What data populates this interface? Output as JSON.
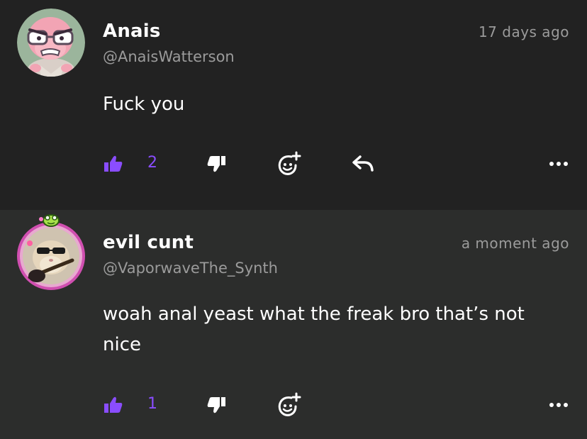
{
  "comments": [
    {
      "username": "Anais",
      "handle": "@AnaisWatterson",
      "timestamp": "17 days ago",
      "text": "Fuck you",
      "likes": "2",
      "has_reply": true
    },
    {
      "username": "evil cunt",
      "handle": "@VaporwaveThe_Synth",
      "timestamp": "a moment ago",
      "text": "woah anal yeast what the freak bro that’s not nice",
      "likes": "1",
      "has_reply": false
    }
  ],
  "icons": {
    "like": "thumbs-up-icon",
    "dislike": "thumbs-down-icon",
    "react": "add-reaction-icon",
    "reply": "reply-icon",
    "more": "more-horizontal-icon"
  },
  "colors": {
    "background": "#222222",
    "background_alt": "#2c2d2c",
    "accent": "#8a4dff",
    "muted_text": "#9b9b9b",
    "text": "#ffffff"
  }
}
